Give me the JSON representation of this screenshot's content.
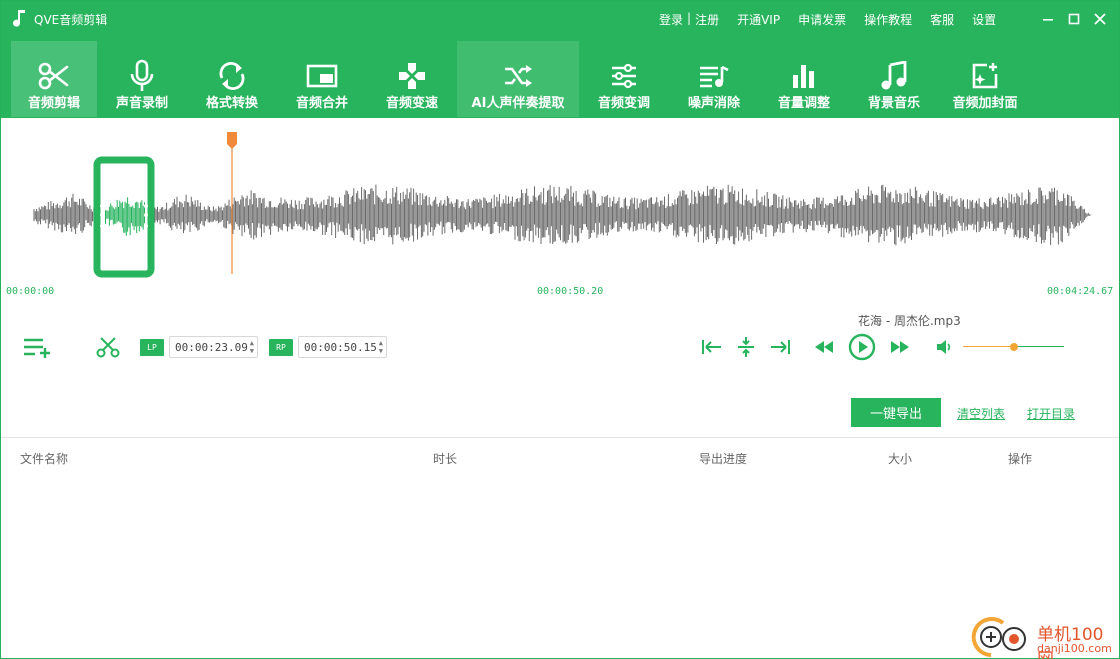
{
  "app": {
    "title": "QVE音频剪辑"
  },
  "top_links": {
    "login": "登录",
    "sep": "|",
    "register": "注册",
    "vip": "开通VIP",
    "invoice": "申请发票",
    "tutorial": "操作教程",
    "service": "客服",
    "settings": "设置"
  },
  "toolbar": [
    {
      "label": "音频剪辑",
      "icon": "scissors-icon"
    },
    {
      "label": "声音录制",
      "icon": "microphone-icon"
    },
    {
      "label": "格式转换",
      "icon": "refresh-icon"
    },
    {
      "label": "音频合并",
      "icon": "merge-icon"
    },
    {
      "label": "音频变速",
      "icon": "gamepad-icon"
    },
    {
      "label": "AI人声伴奏提取",
      "icon": "shuffle-icon"
    },
    {
      "label": "音频变调",
      "icon": "equalizer-icon"
    },
    {
      "label": "噪声消除",
      "icon": "playlist-icon"
    },
    {
      "label": "音量调整",
      "icon": "bars-icon"
    },
    {
      "label": "背景音乐",
      "icon": "music-note-icon"
    },
    {
      "label": "音频加封面",
      "icon": "image-add-icon"
    }
  ],
  "timeline": {
    "start": "00:00:00",
    "middle": "00:00:50.20",
    "end": "00:04:24.67"
  },
  "player": {
    "song_name": "花海 - 周杰伦.mp3",
    "lp_tag": "LP",
    "lp_value": "00:00:23.09",
    "rp_tag": "RP",
    "rp_value": "00:00:50.15",
    "volume": 0.5
  },
  "actions": {
    "export": "一键导出",
    "clear_list": "清空列表",
    "open_dir": "打开目录"
  },
  "table": {
    "columns": [
      "文件名称",
      "时长",
      "导出进度",
      "大小",
      "操作"
    ],
    "rows": []
  },
  "watermark": {
    "line1": "单机100网",
    "line2": "danji100.com"
  },
  "colors": {
    "brand_green": "#27b45d",
    "accent_orange": "#f08a3a",
    "wave_gray": "#6b6b6b"
  }
}
